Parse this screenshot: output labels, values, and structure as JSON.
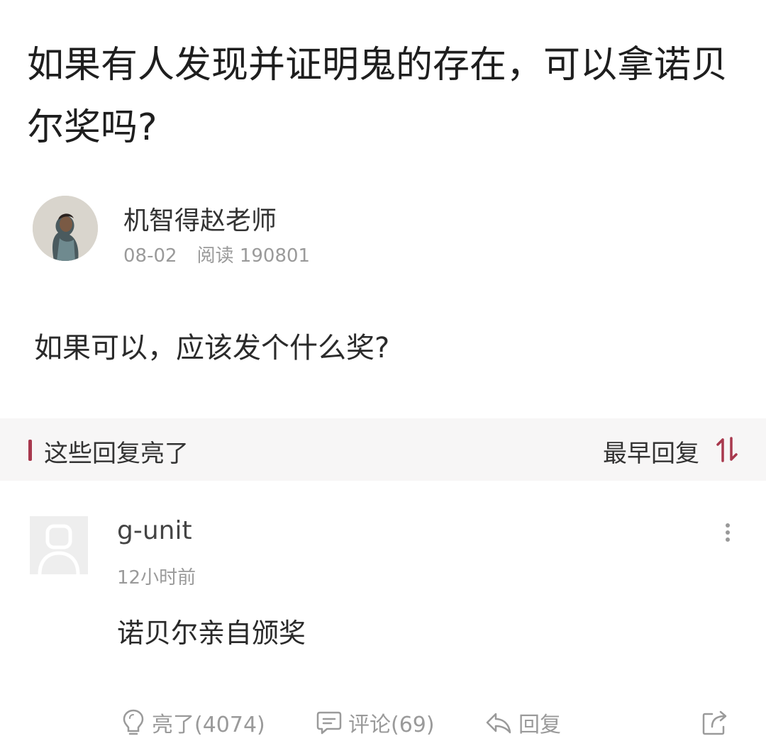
{
  "question": {
    "title": "如果有人发现并证明鬼的存在，可以拿诺贝尔奖吗?",
    "description": "如果可以，应该发个什么奖?"
  },
  "author": {
    "name": "机智得赵老师",
    "date": "08-02",
    "views_label": "阅读 190801"
  },
  "replies_section": {
    "title": "这些回复亮了",
    "sort_label": "最早回复"
  },
  "comment": {
    "user": "g-unit",
    "time": "12小时前",
    "text": "诺贝尔亲自颁奖",
    "like_label": "亮了(4074)",
    "comment_label": "评论(69)",
    "reply_label": "回复"
  },
  "colors": {
    "accent": "#a8384d",
    "muted_text": "#9a9a9a",
    "section_bg": "#f7f6f6"
  }
}
